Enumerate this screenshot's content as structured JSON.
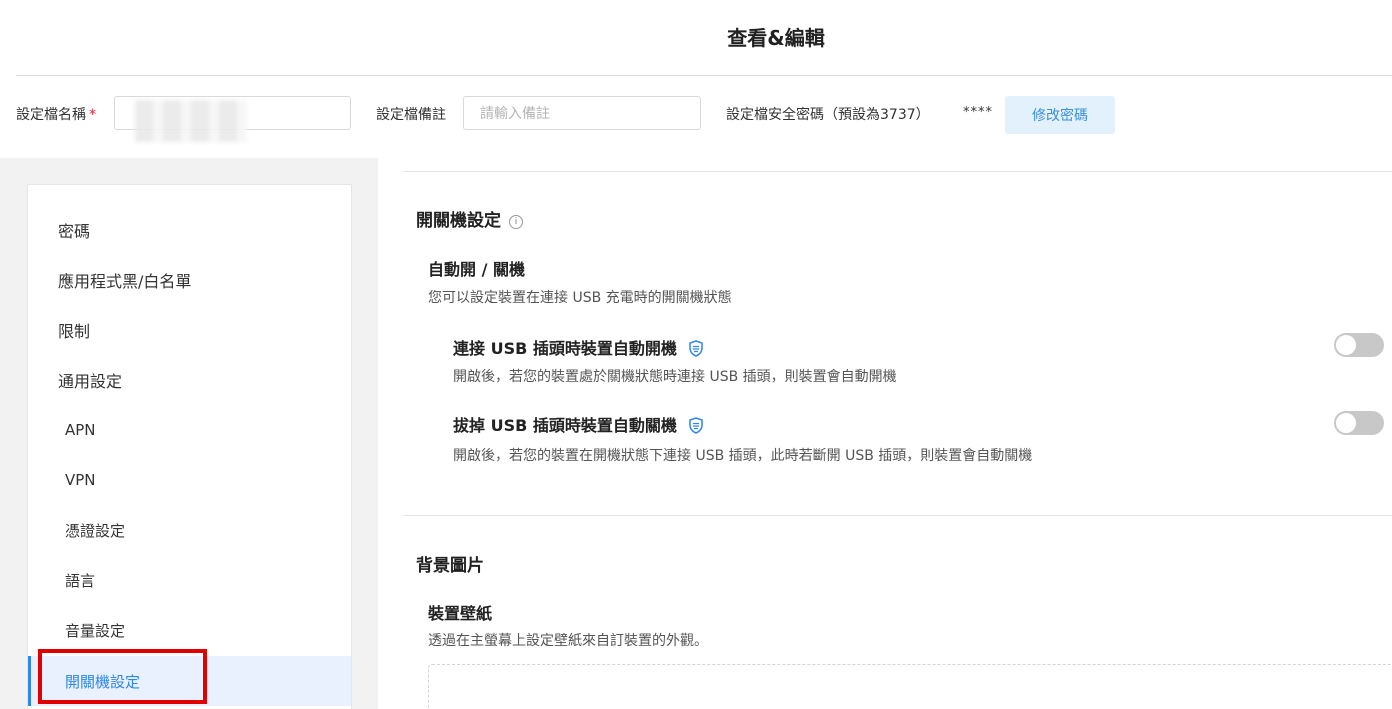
{
  "page": {
    "title": "查看&編輯"
  },
  "form": {
    "profile_name_label": "設定檔名稱",
    "required_mark": "*",
    "profile_note_label": "設定檔備註",
    "profile_note_placeholder": "請輸入備註",
    "security_password_label": "設定檔安全密碼（預設為3737）",
    "password_mask": "****",
    "change_password_button": "修改密碼"
  },
  "sidebar": {
    "items": [
      {
        "label": "密碼"
      },
      {
        "label": "應用程式黑/白名單"
      },
      {
        "label": "限制"
      },
      {
        "label": "通用設定"
      },
      {
        "label": "APN"
      },
      {
        "label": "VPN"
      },
      {
        "label": "憑證設定"
      },
      {
        "label": "語言"
      },
      {
        "label": "音量設定"
      },
      {
        "label": "開關機設定",
        "active": true
      }
    ]
  },
  "power_section": {
    "title": "開關機設定",
    "info_icon": "i",
    "group_title": "自動開 / 關機",
    "group_desc": "您可以設定裝置在連接 USB 充電時的開關機狀態",
    "options": [
      {
        "title": "連接 USB 插頭時裝置自動開機",
        "desc": "開啟後，若您的裝置處於關機狀態時連接 USB 插頭，則裝置會自動開機",
        "enabled": false
      },
      {
        "title": "拔掉 USB 插頭時裝置自動關機",
        "desc": "開啟後，若您的裝置在開機狀態下連接 USB 插頭，此時若斷開 USB 插頭，則裝置會自動關機",
        "enabled": false
      }
    ]
  },
  "background_section": {
    "title": "背景圖片",
    "group_title": "裝置壁紙",
    "group_desc": "透過在主螢幕上設定壁紙來自訂裝置的外觀。"
  },
  "colors": {
    "accent": "#2f86e6",
    "highlight_box": "#e00000",
    "toggle_off": "#c8c8c8"
  }
}
